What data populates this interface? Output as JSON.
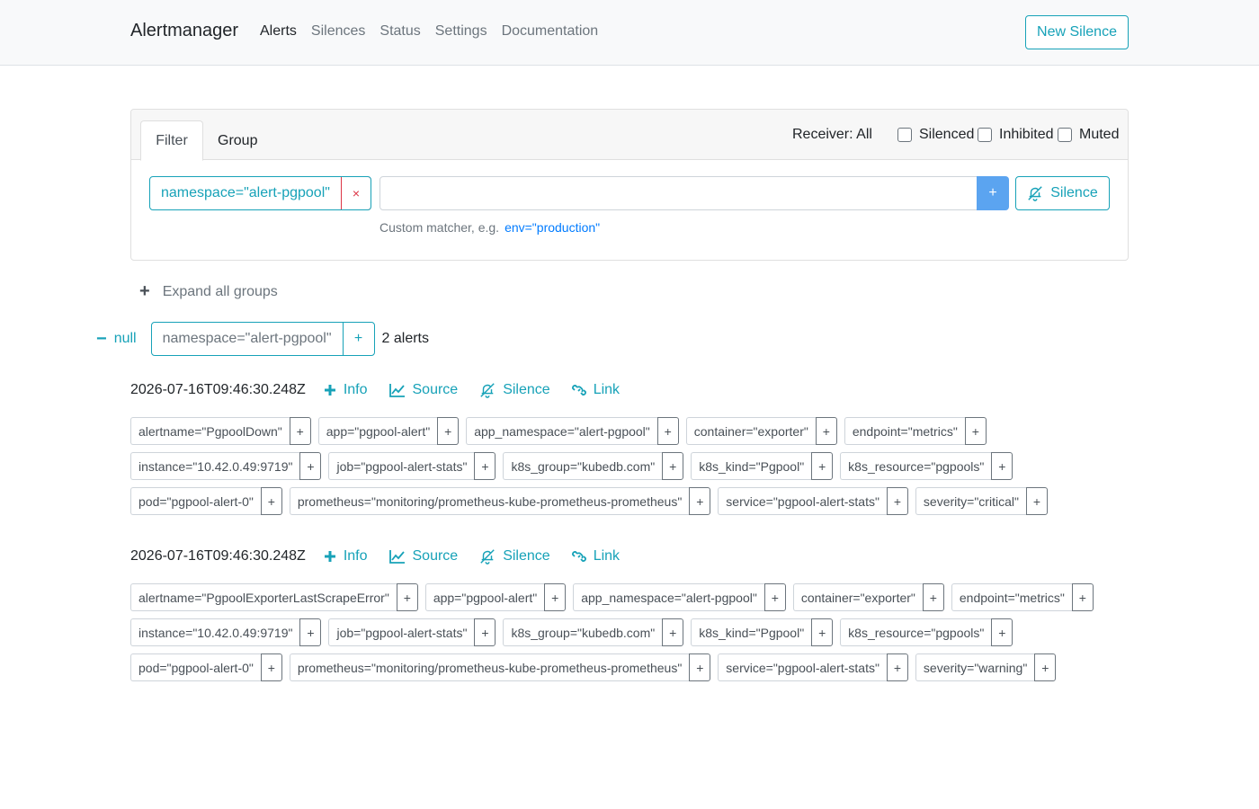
{
  "nav": {
    "brand": "Alertmanager",
    "items": [
      "Alerts",
      "Silences",
      "Status",
      "Settings",
      "Documentation"
    ],
    "new_silence": "New Silence"
  },
  "filter": {
    "tabs": [
      "Filter",
      "Group"
    ],
    "receiver": "Receiver: All",
    "checkboxes": [
      "Silenced",
      "Inhibited",
      "Muted"
    ],
    "matcher": "namespace=\"alert-pgpool\"",
    "remove": "×",
    "input_value": "",
    "add": "+",
    "silence": "Silence",
    "hint": "Custom matcher, e.g.",
    "hint_example": "env=\"production\""
  },
  "expand_all": "Expand all groups",
  "group": {
    "receiver": "null",
    "label": "namespace=\"alert-pgpool\"",
    "add": "+",
    "count": "2 alerts"
  },
  "actions": {
    "info": "Info",
    "source": "Source",
    "silence": "Silence",
    "link": "Link",
    "plus": "+"
  },
  "alerts": [
    {
      "timestamp": "2026-07-16T09:46:30.248Z",
      "rows": [
        [
          "alertname=\"PgpoolDown\"",
          "app=\"pgpool-alert\"",
          "app_namespace=\"alert-pgpool\"",
          "container=\"exporter\"",
          "endpoint=\"metrics\""
        ],
        [
          "instance=\"10.42.0.49:9719\"",
          "job=\"pgpool-alert-stats\"",
          "k8s_group=\"kubedb.com\"",
          "k8s_kind=\"Pgpool\"",
          "k8s_resource=\"pgpools\""
        ],
        [
          "pod=\"pgpool-alert-0\"",
          "prometheus=\"monitoring/prometheus-kube-prometheus-prometheus\"",
          "service=\"pgpool-alert-stats\"",
          "severity=\"critical\""
        ]
      ]
    },
    {
      "timestamp": "2026-07-16T09:46:30.248Z",
      "rows": [
        [
          "alertname=\"PgpoolExporterLastScrapeError\"",
          "app=\"pgpool-alert\"",
          "app_namespace=\"alert-pgpool\"",
          "container=\"exporter\"",
          "endpoint=\"metrics\""
        ],
        [
          "instance=\"10.42.0.49:9719\"",
          "job=\"pgpool-alert-stats\"",
          "k8s_group=\"kubedb.com\"",
          "k8s_kind=\"Pgpool\"",
          "k8s_resource=\"pgpools\""
        ],
        [
          "pod=\"pgpool-alert-0\"",
          "prometheus=\"monitoring/prometheus-kube-prometheus-prometheus\"",
          "service=\"pgpool-alert-stats\"",
          "severity=\"warning\""
        ]
      ]
    }
  ],
  "colors": {
    "accent": "#17a2b8",
    "danger": "#dc3545",
    "primary_btn": "#5ba4f0",
    "muted": "#6c757d"
  }
}
